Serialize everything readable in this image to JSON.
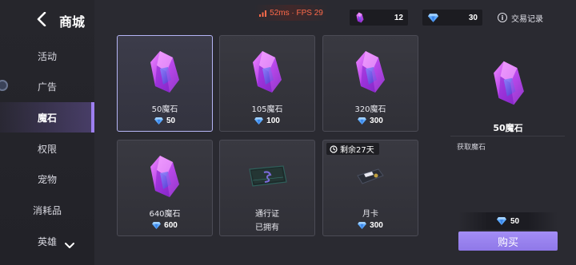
{
  "header": {
    "title": "商城",
    "fps_text": "52ms · FPS 29",
    "trade_record": "交易记录"
  },
  "currencies": [
    {
      "icon": "magic-stone-icon",
      "value": "12"
    },
    {
      "icon": "diamond-icon",
      "value": "30"
    }
  ],
  "sidebar": {
    "items": [
      {
        "label": "活动"
      },
      {
        "label": "广告"
      },
      {
        "label": "魔石"
      },
      {
        "label": "权限"
      },
      {
        "label": "宠物"
      },
      {
        "label": "消耗品"
      },
      {
        "label": "英雄"
      }
    ],
    "active_index": 2
  },
  "products": [
    {
      "name": "50魔石",
      "price": "50"
    },
    {
      "name": "105魔石",
      "price": "100"
    },
    {
      "name": "320魔石",
      "price": "300"
    },
    {
      "name": "640魔石",
      "price": "600"
    },
    {
      "name": "通行证",
      "status": "已拥有"
    },
    {
      "name": "月卡",
      "price": "300",
      "badge": "剩余27天"
    }
  ],
  "detail": {
    "name": "50魔石",
    "description": "获取魔石",
    "price": "50",
    "buy_label": "购买"
  },
  "colors": {
    "accent": "#9d7ff0",
    "buy_button": "#9a84f0",
    "fps_text": "#ff6a4a",
    "diamond": "#5aa8ff",
    "crystal": "#c24cf0"
  }
}
